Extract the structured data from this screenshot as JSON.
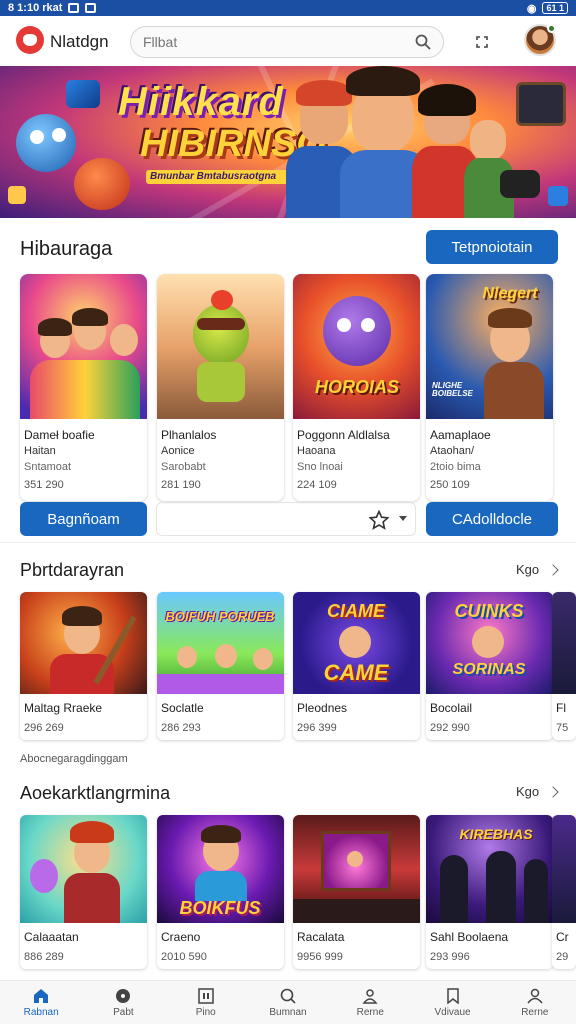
{
  "status_bar": {
    "time": "8 1:10 rkat",
    "battery": "61 1"
  },
  "app_bar": {
    "app_name": "Nlatdgn",
    "search_placeholder": "Fllbat",
    "logo_icon": "game-logo-icon",
    "accent": "#1a67c0"
  },
  "hero": {
    "title_line1": "Hiikkard",
    "title_line2": "HIBIRNSO",
    "tagline": "Bmunbar Bmtabusraotgna"
  },
  "section1": {
    "title": "Hibauraga",
    "action_button": "Tetpnoiotain",
    "cards": [
      {
        "name": "Dameł boafie",
        "line1": "Haitan",
        "line2": "Sntamoat",
        "num": "351 290"
      },
      {
        "name": "Plhanlalos",
        "line1": "Aonice",
        "line2": "Sarobabt",
        "num": "281 190"
      },
      {
        "name": "Poggonn Aldlalsa",
        "line1": "Haoana",
        "line2": "Sno lnoai",
        "num": "224 109"
      },
      {
        "name": "Aamaplaoe",
        "line1": "Ataohan/",
        "line2": "2toio bima",
        "num": "250 109"
      }
    ],
    "card1_thumb_text": "",
    "card3_thumb_text": "HOROIAS",
    "card4_thumb_text": "Nlegert",
    "card4_thumb_sub": "NLIGHE BOIBELSE",
    "left_button": "Bagnñoam",
    "right_button": "CAdolldocle"
  },
  "section2": {
    "title": "Pbrtdarayran",
    "see_all": "Kgo",
    "cards": [
      {
        "name": "Maltag Rraeke",
        "num": "296 269"
      },
      {
        "name": "Soclatle",
        "num": "286 293"
      },
      {
        "name": "Pleodnes",
        "num": "296 399"
      },
      {
        "name": "Bocolail",
        "num": "292 990"
      },
      {
        "name": "Fl",
        "num": "75"
      }
    ],
    "thumb2_text": "BOIFUH PORUEB",
    "thumb3_text_top": "CIAME",
    "thumb3_text_bot": "CAME",
    "thumb4_text_top": "CUINKS",
    "thumb4_text_bot": "SORINAS"
  },
  "caption": "Abocnegaragdinggam",
  "section3": {
    "title": "Aoekarktlangrmina",
    "see_all": "Kgo",
    "cards": [
      {
        "name": "Calaaatan",
        "num": "886 289"
      },
      {
        "name": "Craeno",
        "num": "2010 590"
      },
      {
        "name": "Racalata",
        "num": "9956 999"
      },
      {
        "name": "Sahl Boolaena",
        "num": "293 996"
      },
      {
        "name": "Cr",
        "num": "29"
      }
    ],
    "thumb2_text": "BOIKFUS",
    "thumb4_text": "KIREBHAS"
  },
  "bottom_nav": [
    {
      "label": "Rabnan",
      "icon": "home-icon"
    },
    {
      "label": "Pabt",
      "icon": "disc-icon"
    },
    {
      "label": "Pino",
      "icon": "grid-icon"
    },
    {
      "label": "Bumnan",
      "icon": "search-icon"
    },
    {
      "label": "Rerne",
      "icon": "person-icon"
    },
    {
      "label": "Vdivaue",
      "icon": "bookmark-icon"
    },
    {
      "label": "Rerne",
      "icon": "account-icon"
    }
  ]
}
